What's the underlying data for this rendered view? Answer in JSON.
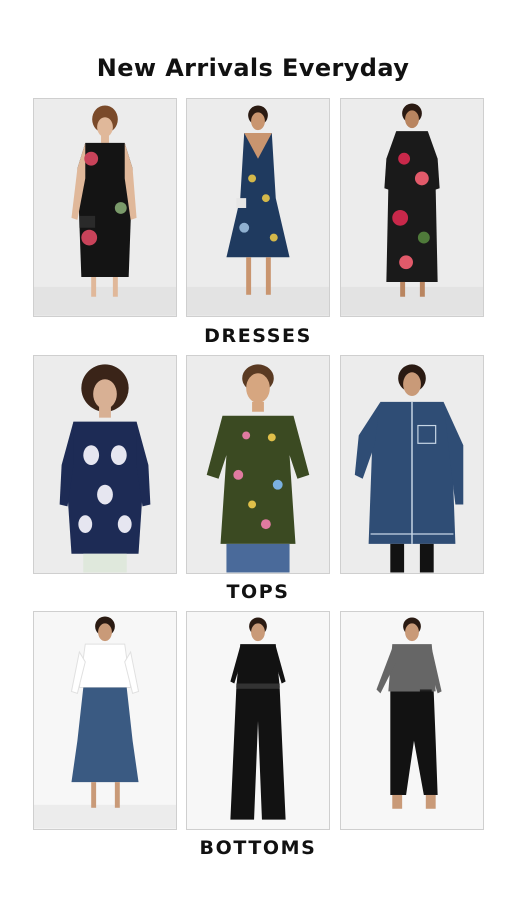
{
  "header": {
    "title": "New Arrivals Everyday"
  },
  "sections": [
    {
      "label": "DRESSES",
      "items": [
        {
          "name": "floral-print-black-dress",
          "colors": {
            "primary": "#141414",
            "accent": "#c9435a"
          }
        },
        {
          "name": "embroidered-denim-dress",
          "colors": {
            "primary": "#1f3a5f",
            "accent": "#d4b84a"
          }
        },
        {
          "name": "floral-print-maxi-dress",
          "colors": {
            "primary": "#1a1a1a",
            "accent": "#c8284a"
          }
        }
      ]
    },
    {
      "label": "TOPS",
      "items": [
        {
          "name": "navy-block-print-top",
          "colors": {
            "primary": "#1d2b55",
            "accent": "#e6e6f0"
          }
        },
        {
          "name": "green-embroidered-top",
          "colors": {
            "primary": "#3b4a22",
            "accent": "#e07aa0"
          }
        },
        {
          "name": "denim-shirt-dress",
          "colors": {
            "primary": "#2f4d75",
            "accent": "#c7d6e6"
          }
        }
      ]
    },
    {
      "label": "BOTTOMS",
      "items": [
        {
          "name": "denim-midi-skirt",
          "colors": {
            "primary": "#3a5a82",
            "accent": "#ffffff"
          }
        },
        {
          "name": "black-wide-leg-jumpsuit",
          "colors": {
            "primary": "#121212",
            "accent": "#333333"
          }
        },
        {
          "name": "black-cropped-pants",
          "colors": {
            "primary": "#121212",
            "accent": "#666666"
          }
        }
      ]
    }
  ]
}
